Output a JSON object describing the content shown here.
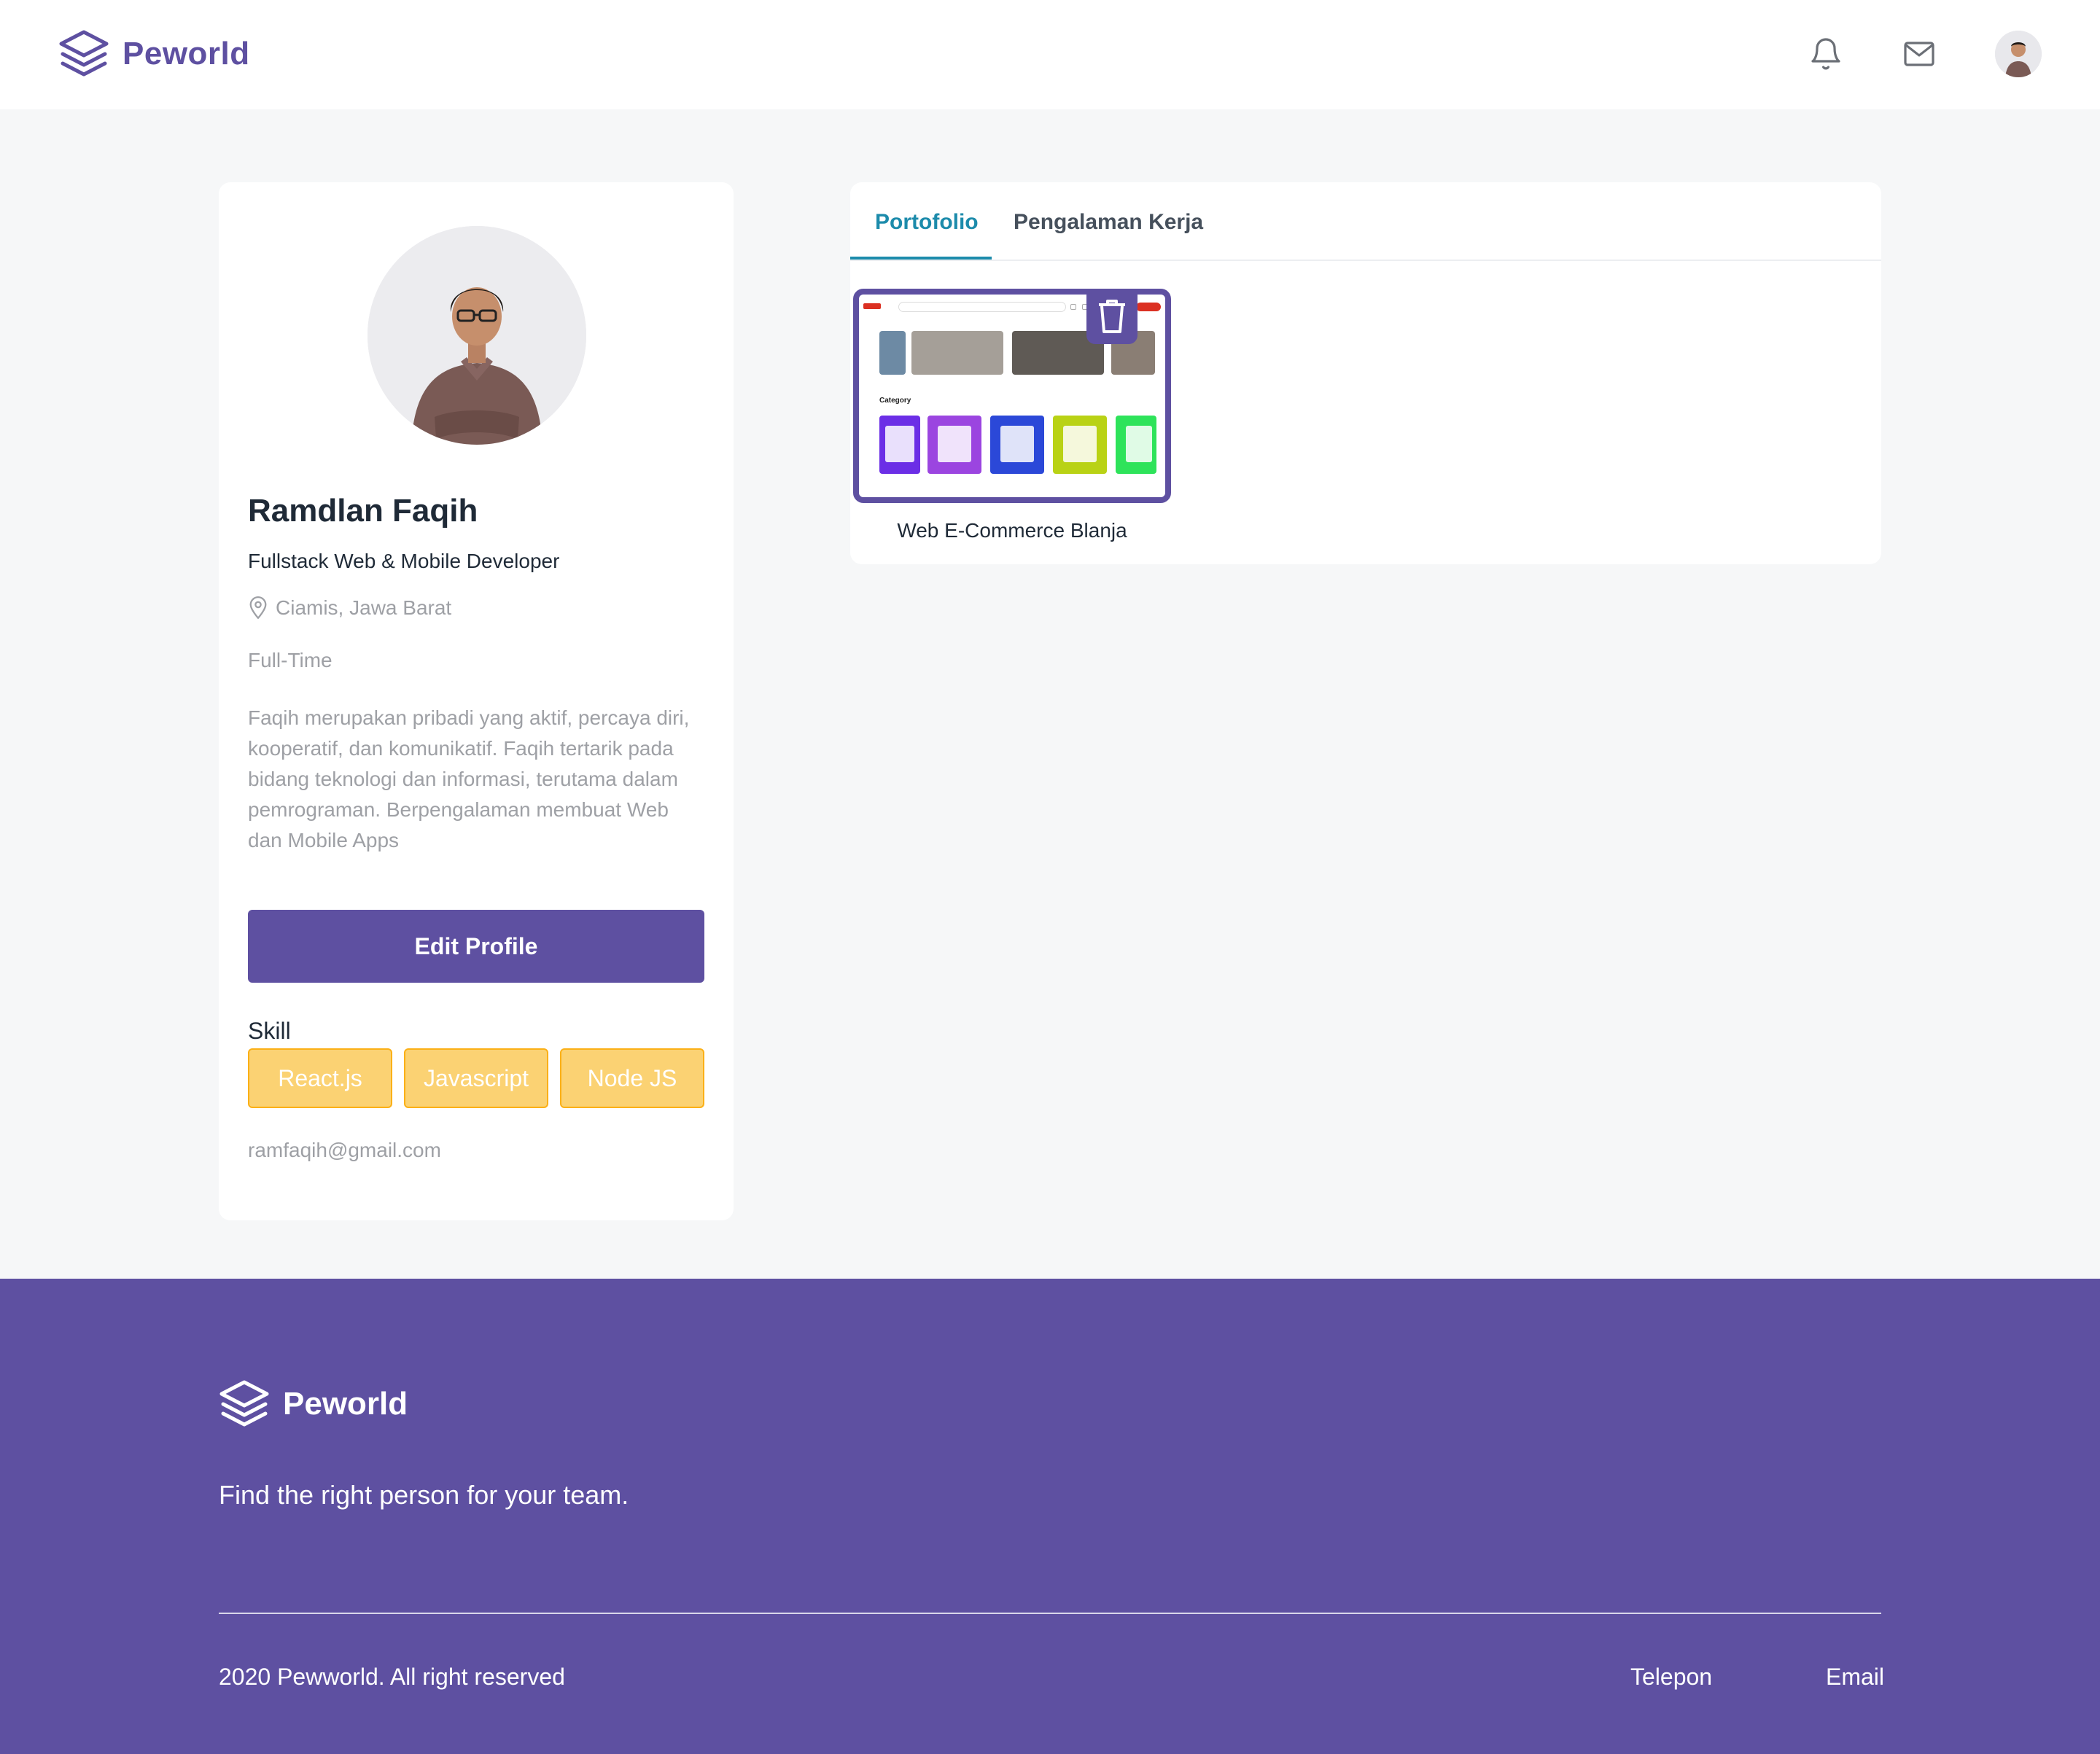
{
  "navbar": {
    "brand": "Peworld",
    "icons": [
      "bell-icon",
      "mail-icon",
      "user-avatar"
    ]
  },
  "profile": {
    "name": "Ramdlan Faqih",
    "job": "Fullstack Web & Mobile Developer",
    "location": "Ciamis, Jawa Barat",
    "job_type": "Full-Time",
    "bio": "Faqih merupakan pribadi yang aktif, percaya diri, kooperatif, dan komunikatif. Faqih tertarik pada bidang teknologi dan informasi, terutama dalam pemrograman. Berpengalaman membuat Web dan Mobile Apps",
    "edit_label": "Edit Profile",
    "skill_title": "Skill",
    "skills": [
      "React.js",
      "Javascript",
      "Node JS"
    ],
    "email": "ramfaqih@gmail.com"
  },
  "portfolio": {
    "tabs": [
      {
        "label": "Portofolio",
        "active": true
      },
      {
        "label": "Pengalaman Kerja",
        "active": false
      }
    ],
    "projects": [
      {
        "title": "Web E-Commerce Blanja"
      }
    ]
  },
  "footer": {
    "brand": "Peworld",
    "tagline": "Find the right person for your team.",
    "copyright": "2020 Pewworld. All right reserved",
    "links": [
      "Telepon",
      "Email"
    ]
  },
  "colors": {
    "primary": "#5e50a1",
    "accent_tab": "#1c8bab",
    "skill_bg": "#fbd273",
    "skill_border": "#fbb017",
    "page_bg": "#f6f7f8",
    "muted_text": "#9ea0a5"
  }
}
